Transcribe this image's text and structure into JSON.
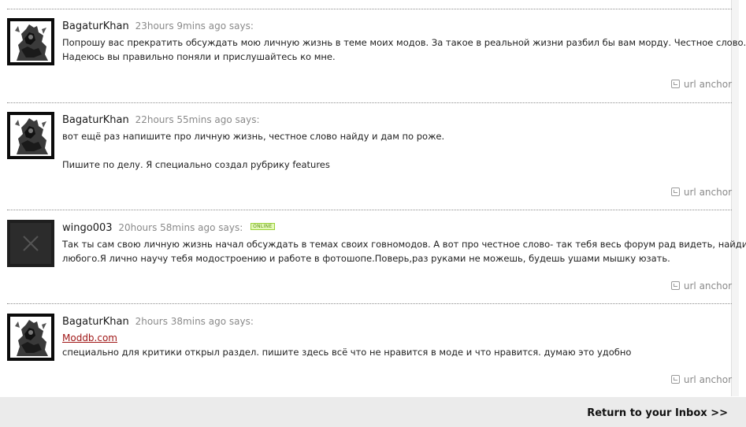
{
  "comments": [
    {
      "author": "BagaturKhan",
      "time": "23hours 9mins ago",
      "says": "says:",
      "online": false,
      "lines": [
        "Попрошу вас прекратить обсуждать мою личную жизнь в теме моих модов. За такое в реальной жизни разбил бы вам морду. Честное слово.",
        "Надеюсь вы правильно поняли и прислушайтесь ко мне."
      ],
      "anchor": "url anchor"
    },
    {
      "author": "BagaturKhan",
      "time": "22hours 55mins ago",
      "says": "says:",
      "online": false,
      "lines": [
        "вот ещё раз напишите про личную жизнь, честное слово найду и дам по роже.",
        "Пишите по делу. Я специально создал рубрику features"
      ],
      "anchor": "url anchor"
    },
    {
      "author": "wingo003",
      "time": "20hours 58mins ago",
      "says": "says:",
      "online": true,
      "online_label": "ONLINE",
      "lines": [
        "Так ты сам свою личную жизнь начал обсуждать в темах своих говномодов. А вот про честное слово- так тебя весь форум рад видеть, найди",
        "любого.Я лично научу тебя модостроению и работе в фотошопе.Поверь,раз руками не можешь, будешь ушами мышку юзать."
      ],
      "anchor": "url anchor"
    },
    {
      "author": "BagaturKhan",
      "time": "2hours 38mins ago",
      "says": "says:",
      "online": false,
      "link": "Moddb.com",
      "lines": [
        "специально для критики открыл раздел. пишите здесь всё что не нравится в моде и что нравится. думаю это удобно"
      ],
      "anchor": "url anchor"
    }
  ],
  "footer": {
    "return_label": "Return to your Inbox >>"
  },
  "colors": {
    "link": "#a01818",
    "muted": "#8a8a8a",
    "online_badge": "#9ad038",
    "footer_bg": "#ebebeb"
  },
  "icons": {
    "avatar_user": "warrior-avatar-icon",
    "avatar_placeholder": "no-avatar-x-icon",
    "anchor": "anchor-link-icon"
  }
}
